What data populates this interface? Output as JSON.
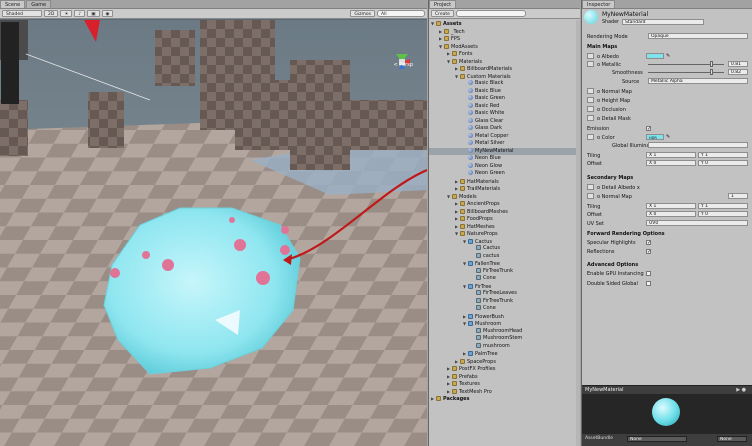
{
  "scene": {
    "tabs": [
      "Scene",
      "Game"
    ],
    "shading": "Shaded",
    "mode_2d": "2D",
    "gizmos": "Gizmos",
    "search": "All",
    "persp": "< Persp"
  },
  "project": {
    "tab": "Project",
    "create": "Create",
    "items": [
      {
        "label": "Assets",
        "depth": 0,
        "icon": "folder",
        "open": true,
        "bold": true
      },
      {
        "label": "_Tech",
        "depth": 1,
        "icon": "folder",
        "open": false
      },
      {
        "label": "FPS",
        "depth": 1,
        "icon": "folder",
        "open": false
      },
      {
        "label": "ModAssets",
        "depth": 1,
        "icon": "folder",
        "open": true
      },
      {
        "label": "Fonts",
        "depth": 2,
        "icon": "folder",
        "open": false
      },
      {
        "label": "Materials",
        "depth": 2,
        "icon": "folder",
        "open": true
      },
      {
        "label": "BillboardMaterials",
        "depth": 3,
        "icon": "folder",
        "open": false
      },
      {
        "label": "Custom Materials",
        "depth": 3,
        "icon": "folder",
        "open": true
      },
      {
        "label": "Basic Black",
        "depth": 4,
        "icon": "sphere"
      },
      {
        "label": "Basic Blue",
        "depth": 4,
        "icon": "sphere"
      },
      {
        "label": "Basic Green",
        "depth": 4,
        "icon": "sphere"
      },
      {
        "label": "Basic Red",
        "depth": 4,
        "icon": "sphere"
      },
      {
        "label": "Basic White",
        "depth": 4,
        "icon": "sphere"
      },
      {
        "label": "Glass Clear",
        "depth": 4,
        "icon": "sphere"
      },
      {
        "label": "Glass Dark",
        "depth": 4,
        "icon": "sphere"
      },
      {
        "label": "Metal Copper",
        "depth": 4,
        "icon": "sphere"
      },
      {
        "label": "Metal Silver",
        "depth": 4,
        "icon": "sphere"
      },
      {
        "label": "MyNewMaterial",
        "depth": 4,
        "icon": "sphere",
        "selected": true
      },
      {
        "label": "Neon Blue",
        "depth": 4,
        "icon": "sphere"
      },
      {
        "label": "Neon Glow",
        "depth": 4,
        "icon": "sphere"
      },
      {
        "label": "Neon Green",
        "depth": 4,
        "icon": "sphere"
      },
      {
        "label": "HatMaterials",
        "depth": 3,
        "icon": "folder",
        "open": false
      },
      {
        "label": "TrailMaterials",
        "depth": 3,
        "icon": "folder",
        "open": false
      },
      {
        "label": "Models",
        "depth": 2,
        "icon": "folder",
        "open": true
      },
      {
        "label": "AncientProps",
        "depth": 3,
        "icon": "folder",
        "open": false
      },
      {
        "label": "BillboardMeshes",
        "depth": 3,
        "icon": "folder",
        "open": false
      },
      {
        "label": "FoodProps",
        "depth": 3,
        "icon": "folder",
        "open": false
      },
      {
        "label": "HatMeshes",
        "depth": 3,
        "icon": "folder",
        "open": false
      },
      {
        "label": "NatureProps",
        "depth": 3,
        "icon": "folder",
        "open": true
      },
      {
        "label": "Cactus",
        "depth": 4,
        "icon": "prefab",
        "open": true
      },
      {
        "label": "Cactus",
        "depth": 5,
        "icon": "mesh"
      },
      {
        "label": "cactus",
        "depth": 5,
        "icon": "mesh"
      },
      {
        "label": "FallenTree",
        "depth": 4,
        "icon": "prefab",
        "open": true
      },
      {
        "label": "FirTreeTrunk",
        "depth": 5,
        "icon": "mesh"
      },
      {
        "label": "Cone",
        "depth": 5,
        "icon": "mesh"
      },
      {
        "label": "FirTree",
        "depth": 4,
        "icon": "prefab",
        "open": true
      },
      {
        "label": "FirTreeLeaves",
        "depth": 5,
        "icon": "mesh"
      },
      {
        "label": "FirTreeTrunk",
        "depth": 5,
        "icon": "mesh"
      },
      {
        "label": "Cone",
        "depth": 5,
        "icon": "mesh"
      },
      {
        "label": "FlowerBush",
        "depth": 4,
        "icon": "prefab",
        "open": false
      },
      {
        "label": "Mushroom",
        "depth": 4,
        "icon": "prefab",
        "open": true
      },
      {
        "label": "MushroomHead",
        "depth": 5,
        "icon": "mesh"
      },
      {
        "label": "MushroomStem",
        "depth": 5,
        "icon": "mesh"
      },
      {
        "label": "mushroom",
        "depth": 5,
        "icon": "mesh"
      },
      {
        "label": "PalmTree",
        "depth": 4,
        "icon": "prefab",
        "open": false
      },
      {
        "label": "SpaceProps",
        "depth": 3,
        "icon": "folder",
        "open": false
      },
      {
        "label": "PostFX Profiles",
        "depth": 2,
        "icon": "folder",
        "open": false
      },
      {
        "label": "Prefabs",
        "depth": 2,
        "icon": "folder",
        "open": false
      },
      {
        "label": "Textures",
        "depth": 2,
        "icon": "folder",
        "open": false
      },
      {
        "label": "TextMesh Pro",
        "depth": 2,
        "icon": "folder",
        "open": false
      },
      {
        "label": "Packages",
        "depth": 0,
        "icon": "folder",
        "open": false,
        "bold": true
      }
    ]
  },
  "inspector": {
    "tab": "Inspector",
    "material_name": "MyNewMaterial",
    "shader_label": "Shader",
    "shader_value": "Standard",
    "rendering_mode_label": "Rendering Mode",
    "rendering_mode_value": "Opaque",
    "main_maps": "Main Maps",
    "albedo": "o Albedo",
    "metallic": "o Metallic",
    "metallic_value": "0.81",
    "smoothness": "Smoothness",
    "smoothness_value": "0.82",
    "source": "Source",
    "source_value": "Metallic Alpha",
    "normal_map": "o Normal Map",
    "height_map": "o Height Map",
    "occlusion": "o Occlusion",
    "detail_mask": "o Detail Mask",
    "emission": "Emission",
    "color": "o Color",
    "color_value": "HDR",
    "global_illum": "Global Illumina",
    "tiling": "Tiling",
    "offset": "Offset",
    "tiling_x": "X 1",
    "tiling_y": "Y 1",
    "offset_x": "X 0",
    "offset_y": "Y 0",
    "secondary_maps": "Secondary Maps",
    "detail_albedo": "o Detail Albedo x",
    "normal_map2": "o Normal Map",
    "normal_map2_value": "1",
    "tiling2": "Tiling",
    "offset2": "Offset",
    "tiling2_x": "X 1",
    "tiling2_y": "Y 1",
    "offset2_x": "X 0",
    "offset2_y": "Y 0",
    "uv_set": "UV Set",
    "uv_set_value": "UV0",
    "forward_options": "Forward Rendering Options",
    "specular": "Specular Highlights",
    "reflections": "Reflections",
    "advanced": "Advanced Options",
    "gpu_instancing": "Enable GPU Instancing",
    "double_sided": "Double Sided Global",
    "preview_title": "MyNewMaterial",
    "asset_bundle": "AssetBundle",
    "asset_bundle_value": "None",
    "asset_bundle_value2": "None",
    "albedo_color": "#7fe3ec"
  }
}
